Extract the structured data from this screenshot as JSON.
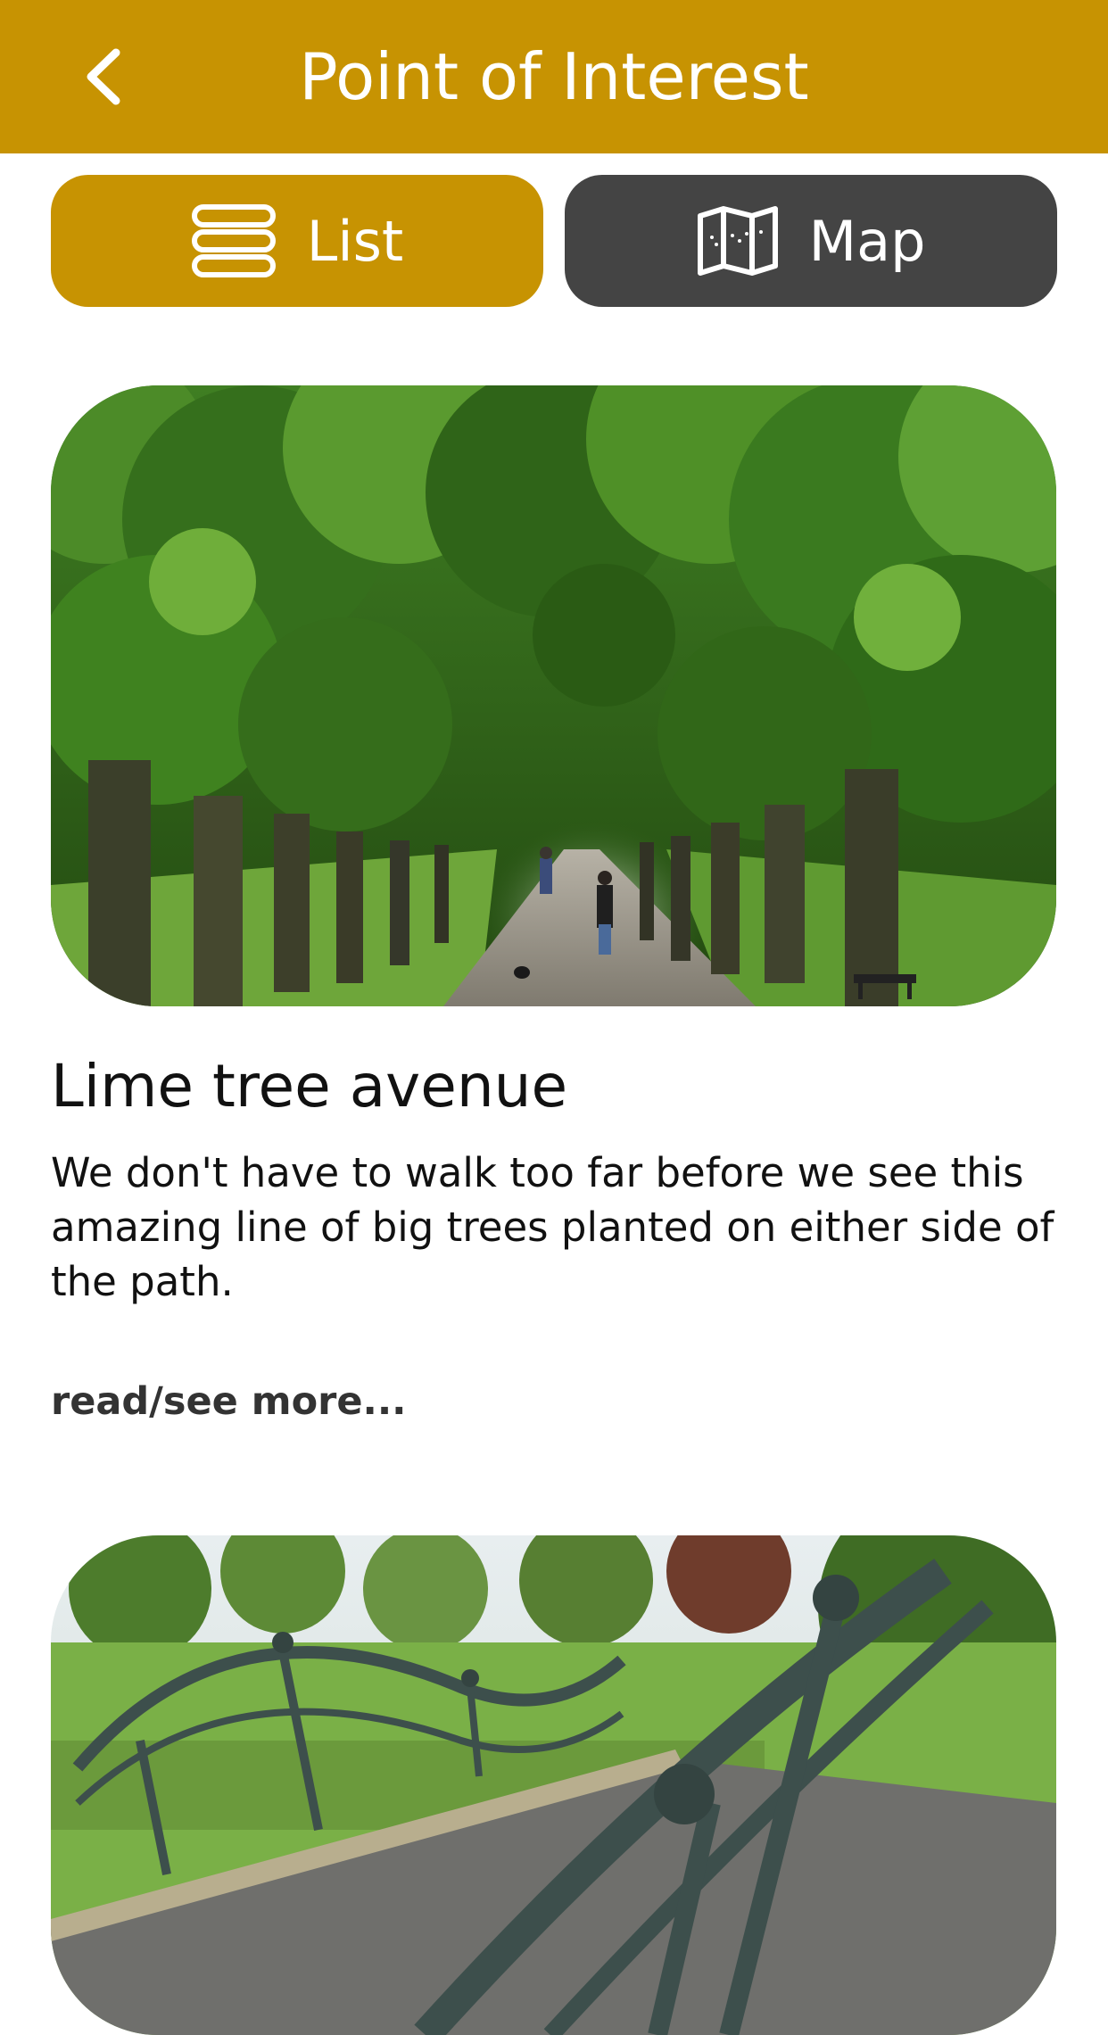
{
  "header": {
    "title": "Point of Interest",
    "back_icon": "chevron-left-icon",
    "background_color": "#c79302"
  },
  "view_toggle": {
    "list": {
      "label": "List",
      "icon": "list-icon",
      "selected": true,
      "color": "#c79302"
    },
    "map": {
      "label": "Map",
      "icon": "map-icon",
      "selected": false,
      "color": "#444444"
    }
  },
  "points": [
    {
      "title": "Lime tree avenue",
      "description": "We don't have to walk too far before we see this amazing line of big trees planted on either side of the path.",
      "read_more": "read/see more..."
    }
  ]
}
